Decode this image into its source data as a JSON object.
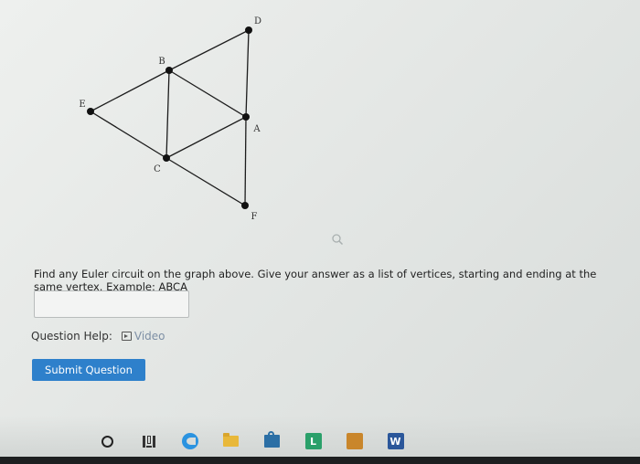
{
  "graph": {
    "vertices": [
      {
        "id": "D",
        "label": "D"
      },
      {
        "id": "B",
        "label": "B"
      },
      {
        "id": "E",
        "label": "E"
      },
      {
        "id": "A",
        "label": "A"
      },
      {
        "id": "C",
        "label": "C"
      },
      {
        "id": "F",
        "label": "F"
      }
    ],
    "edges": [
      [
        "E",
        "B"
      ],
      [
        "E",
        "C"
      ],
      [
        "B",
        "D"
      ],
      [
        "B",
        "A"
      ],
      [
        "B",
        "C"
      ],
      [
        "D",
        "A"
      ],
      [
        "A",
        "C"
      ],
      [
        "A",
        "F"
      ],
      [
        "C",
        "F"
      ]
    ]
  },
  "question": {
    "text": "Find any Euler circuit on the graph above. Give your answer as a list of vertices, starting and ending at the same vertex. Example: ABCA",
    "answer_value": "",
    "help_label": "Question Help:",
    "video_label": "Video",
    "submit_label": "Submit Question"
  },
  "taskbar": {
    "items": [
      {
        "name": "cortana-icon"
      },
      {
        "name": "task-view-icon"
      },
      {
        "name": "edge-browser-icon"
      },
      {
        "name": "file-explorer-icon"
      },
      {
        "name": "store-icon"
      },
      {
        "name": "l-app-icon",
        "letter": "L",
        "color": "#2aa06a"
      },
      {
        "name": "orange-app-icon",
        "letter": "",
        "color": "#c9862b"
      },
      {
        "name": "word-icon",
        "letter": "W",
        "color": "#2b579a"
      }
    ]
  }
}
